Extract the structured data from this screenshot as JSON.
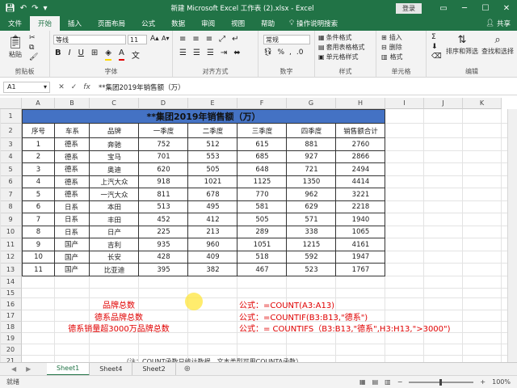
{
  "titlebar": {
    "title": "新建 Microsoft Excel 工作表 (2).xlsx  -  Excel",
    "login": "登录",
    "save_icon": "save-icon",
    "undo_icon": "undo-icon",
    "redo_icon": "redo-icon"
  },
  "tabs": [
    "文件",
    "开始",
    "插入",
    "页面布局",
    "公式",
    "数据",
    "审阅",
    "视图",
    "帮助"
  ],
  "active_tab": "开始",
  "tell_me": "操作说明搜索",
  "share": "共享",
  "ribbon": {
    "paste": "粘贴",
    "clipboard": "剪贴板",
    "font_name": "等线",
    "font_size": "11",
    "font_group": "字体",
    "align_group": "对齐方式",
    "number_format": "常规",
    "number_group": "数字",
    "cond_format": "条件格式",
    "table_format": "套用表格格式",
    "cell_style": "单元格样式",
    "styles_group": "样式",
    "insert": "插入",
    "delete": "删除",
    "format": "格式",
    "cells_group": "单元格",
    "sort_filter": "排序和筛选",
    "find_select": "查找和选择",
    "editing_group": "编辑"
  },
  "formula_bar": {
    "name_box": "A1",
    "value": "**集团2019年销售额（万）"
  },
  "columns": [
    "A",
    "B",
    "C",
    "D",
    "E",
    "F",
    "G",
    "H",
    "I",
    "J",
    "K"
  ],
  "rows": [
    "1",
    "2",
    "3",
    "4",
    "5",
    "6",
    "7",
    "8",
    "9",
    "10",
    "11",
    "12",
    "13",
    "14",
    "15",
    "16",
    "17",
    "18",
    "19",
    "20",
    "21"
  ],
  "table": {
    "title": "**集团2019年销售额（万）",
    "headers": [
      "序号",
      "车系",
      "品牌",
      "一季度",
      "二季度",
      "三季度",
      "四季度",
      "销售额合计"
    ],
    "rows": [
      [
        "1",
        "德系",
        "奔驰",
        "752",
        "512",
        "615",
        "881",
        "2760"
      ],
      [
        "2",
        "德系",
        "宝马",
        "701",
        "553",
        "685",
        "927",
        "2866"
      ],
      [
        "3",
        "德系",
        "奥迪",
        "620",
        "505",
        "648",
        "721",
        "2494"
      ],
      [
        "4",
        "德系",
        "上汽大众",
        "918",
        "1021",
        "1125",
        "1350",
        "4414"
      ],
      [
        "5",
        "德系",
        "一汽大众",
        "811",
        "678",
        "770",
        "962",
        "3221"
      ],
      [
        "6",
        "日系",
        "本田",
        "513",
        "495",
        "581",
        "629",
        "2218"
      ],
      [
        "7",
        "日系",
        "丰田",
        "452",
        "412",
        "505",
        "571",
        "1940"
      ],
      [
        "8",
        "日系",
        "日产",
        "225",
        "213",
        "289",
        "338",
        "1065"
      ],
      [
        "9",
        "国产",
        "吉利",
        "935",
        "960",
        "1051",
        "1215",
        "4161"
      ],
      [
        "10",
        "国产",
        "长安",
        "428",
        "409",
        "518",
        "592",
        "1947"
      ],
      [
        "11",
        "国产",
        "比亚迪",
        "395",
        "382",
        "467",
        "523",
        "1767"
      ]
    ]
  },
  "notes": {
    "label1": "品牌总数",
    "label2": "德系品牌总数",
    "label3": "德系销量超3000万品牌总数",
    "formula1": "公式：=COUNT(A3:A13)",
    "formula2": "公式：=COUNTIF(B3:B13,\"德系\")",
    "formula3": "公式：= COUNTIFS（B3:B13,\"德系\",H3:H13,\">3000\")",
    "footnote": "（注：COUNT函数只统计数据，文本类型可用COUNTA函数）"
  },
  "sheets": [
    "Sheet1",
    "Sheet4",
    "Sheet2"
  ],
  "active_sheet": "Sheet1",
  "status": {
    "ready": "就绪",
    "zoom": "100%"
  },
  "colors": {
    "excel_green": "#217346",
    "title_band": "#4472c4",
    "red_text": "#e00000"
  }
}
